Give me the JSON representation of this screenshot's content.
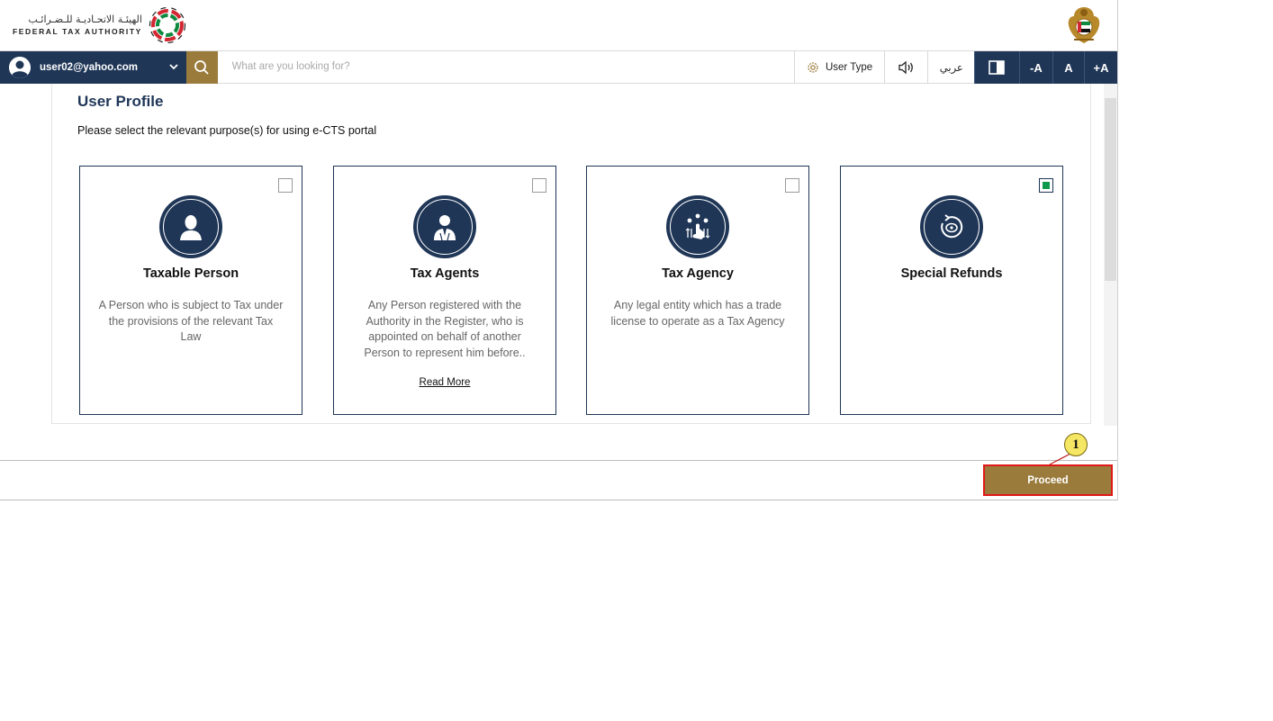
{
  "header": {
    "logo_text_ar": "الهيئـة الاتحـاديـة للـضـرائـب",
    "logo_text_en": "FEDERAL TAX AUTHORITY",
    "emblem_icon": "uae-emblem-icon"
  },
  "toolbar": {
    "user_email": "user02@yahoo.com",
    "search_placeholder": "What are you looking for?",
    "user_type_label": "User Type",
    "language_label": "عربي",
    "font_decrease": "-A",
    "font_normal": "A",
    "font_increase": "+A",
    "colors": {
      "navy": "#1f3657",
      "gold": "#9b7b3c"
    }
  },
  "main": {
    "title": "User Profile",
    "instruction": "Please select the relevant purpose(s) for using e-CTS portal",
    "cards": [
      {
        "title": "Taxable Person",
        "description": "A Person who is subject to Tax under the provisions of the relevant Tax Law",
        "checked": false,
        "icon": "person-silhouette-icon"
      },
      {
        "title": "Tax Agents",
        "description": "Any Person registered with the Authority in the Register, who is appointed on behalf of another Person to represent him before..",
        "read_more": "Read More",
        "checked": false,
        "icon": "agent-suit-icon"
      },
      {
        "title": "Tax Agency",
        "description": "Any legal entity which has a trade license to operate as a Tax Agency",
        "checked": false,
        "icon": "agency-network-icon"
      },
      {
        "title": "Special Refunds",
        "description": "",
        "checked": true,
        "icon": "refund-cycle-icon"
      }
    ]
  },
  "footer": {
    "proceed_label": "Proceed",
    "callout_number": "1"
  }
}
